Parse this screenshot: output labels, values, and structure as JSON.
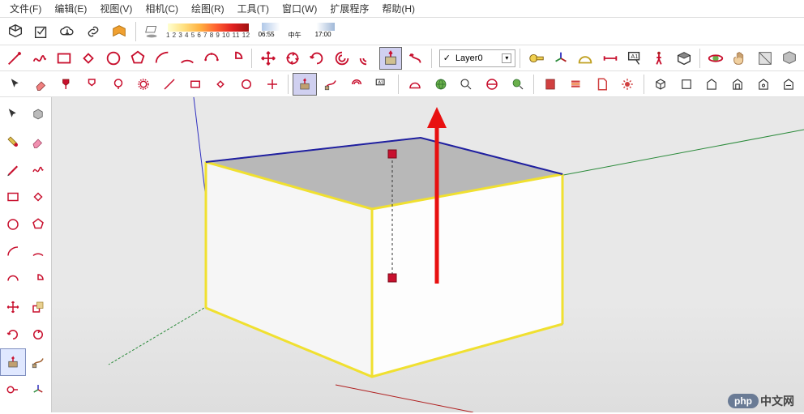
{
  "menu": {
    "file": "文件(F)",
    "edit": "编辑(E)",
    "view": "视图(V)",
    "camera": "相机(C)",
    "draw": "绘图(R)",
    "tools": "工具(T)",
    "window": "窗口(W)",
    "extensions": "扩展程序",
    "help": "帮助(H)"
  },
  "toolbar_top": {
    "color_scale_numbers": "1 2 3 4 5 6 7 8 9 10 11 12",
    "time_start": "06:55",
    "time_mid": "中午",
    "time_end": "17:00"
  },
  "toolbar_draw": {
    "icons": [
      "line",
      "freehand",
      "rectangle",
      "rotated-rect",
      "circle",
      "polygon",
      "arc",
      "arc2",
      "arc3",
      "pie",
      "filler1",
      "move",
      "rotate",
      "scale",
      "axis-move",
      "rotate-arrows",
      "rotate-cw",
      "swirl1",
      "swirl2",
      "pushpull-tex",
      "swirl3"
    ]
  },
  "layer": {
    "selected": "Layer0",
    "check": "✓"
  },
  "toolbar_right": {
    "icons": [
      "tape",
      "axes",
      "protractor",
      "dimension",
      "text",
      "walk",
      "look",
      "section",
      "orbit",
      "pan",
      "zoom",
      "zoom-window"
    ]
  },
  "second_row": {
    "icons": [
      "select",
      "eraser",
      "paint",
      "paint2",
      "paint3",
      "circle-halo",
      "line-red",
      "rect-red",
      "rect-rotated",
      "circ-red",
      "mover",
      "pushpull-solid",
      "pushpull",
      "dimtool",
      "tag",
      "spacer",
      "prot-red",
      "globe",
      "search",
      "globe2",
      "lens",
      "book",
      "stack",
      "file",
      "settings",
      "home1",
      "home2",
      "home3",
      "home4",
      "home5",
      "home6"
    ]
  },
  "side": {
    "rows": [
      [
        "select-arrow",
        "cube-shaded"
      ],
      [
        "palette",
        "eraser-pink"
      ],
      [
        "pencil",
        "freehand-red"
      ],
      [
        "rect-red",
        "rect-rotated-red"
      ],
      [
        "circle-red",
        "polygon-red"
      ],
      [
        "arc-red",
        "arc2-red"
      ],
      [
        "arc3-red",
        "pie-red"
      ],
      [
        "move-red",
        "stretch-red"
      ],
      [
        "rotate-red",
        "rotate2-red"
      ],
      [
        "pushpull-shaded",
        "pushpull-brown"
      ],
      [
        "tape-red",
        "axes-red"
      ]
    ],
    "selected_row": 9,
    "selected_col": 0
  },
  "viewport": {
    "axes_colors": {
      "x": "#b02020",
      "y": "#2a8a3a",
      "z": "#3030c0"
    },
    "box_edge_highlight": "#f0e030",
    "arrow_color": "#e81010"
  },
  "watermark": {
    "badge": "php",
    "text": "中文网"
  }
}
